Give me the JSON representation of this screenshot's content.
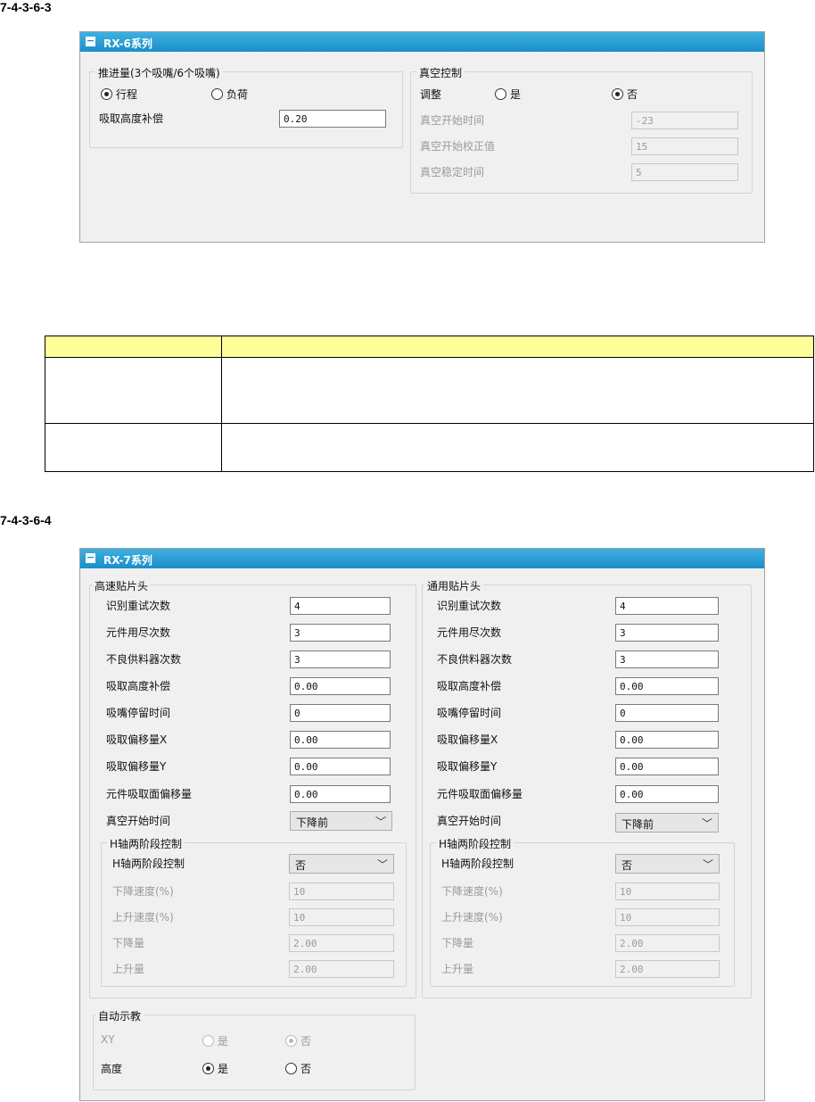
{
  "sec1": {
    "num": "7-4-3-6-3",
    "panel_title": "RX-6系列",
    "thrust": {
      "title": "推进量(3个吸嘴/6个吸嘴)",
      "opt1": "行程",
      "opt2": "负荷",
      "comp_label": "吸取高度补偿",
      "comp_value": "0.20"
    },
    "vacuum": {
      "title": "真空控制",
      "adjust_label": "调整",
      "yes": "是",
      "no": "否",
      "rows": [
        {
          "label": "真空开始时间",
          "value": "-23"
        },
        {
          "label": "真空开始校正值",
          "value": "15"
        },
        {
          "label": "真空稳定时间",
          "value": "5"
        }
      ]
    }
  },
  "sec2": {
    "num": "7-4-3-6-4",
    "panel_title": "RX-7系列",
    "heads": [
      {
        "title": "高速贴片头",
        "fields": [
          {
            "label": "识别重试次数",
            "value": "4"
          },
          {
            "label": "元件用尽次数",
            "value": "3"
          },
          {
            "label": "不良供料器次数",
            "value": "3"
          },
          {
            "label": "吸取高度补偿",
            "value": "0.00"
          },
          {
            "label": "吸嘴停留时间",
            "value": "0"
          },
          {
            "label": "吸取偏移量X",
            "value": "0.00"
          },
          {
            "label": "吸取偏移量Y",
            "value": "0.00"
          },
          {
            "label": "元件吸取面偏移量",
            "value": "0.00"
          }
        ],
        "vacuum_label": "真空开始时间",
        "vacuum_value": "下降前",
        "h_group_title": "H轴两阶段控制",
        "h_label": "H轴两阶段控制",
        "h_value": "否",
        "h_fields": [
          {
            "label": "下降速度(%)",
            "value": "10"
          },
          {
            "label": "上升速度(%)",
            "value": "10"
          },
          {
            "label": "下降量",
            "value": "2.00"
          },
          {
            "label": "上升量",
            "value": "2.00"
          }
        ]
      },
      {
        "title": "通用贴片头",
        "fields": [
          {
            "label": "识别重试次数",
            "value": "4"
          },
          {
            "label": "元件用尽次数",
            "value": "3"
          },
          {
            "label": "不良供料器次数",
            "value": "3"
          },
          {
            "label": "吸取高度补偿",
            "value": "0.00"
          },
          {
            "label": "吸嘴停留时间",
            "value": "0"
          },
          {
            "label": "吸取偏移量X",
            "value": "0.00"
          },
          {
            "label": "吸取偏移量Y",
            "value": "0.00"
          },
          {
            "label": "元件吸取面偏移量",
            "value": "0.00"
          }
        ],
        "vacuum_label": "真空开始时间",
        "vacuum_value": "下降前",
        "h_group_title": "H轴两阶段控制",
        "h_label": "H轴两阶段控制",
        "h_value": "否",
        "h_fields": [
          {
            "label": "下降速度(%)",
            "value": "10"
          },
          {
            "label": "上升速度(%)",
            "value": "10"
          },
          {
            "label": "下降量",
            "value": "2.00"
          },
          {
            "label": "上升量",
            "value": "2.00"
          }
        ]
      }
    ],
    "auto_teach": {
      "title": "自动示教",
      "xy_label": "XY",
      "height_label": "高度",
      "yes": "是",
      "no": "否"
    }
  }
}
